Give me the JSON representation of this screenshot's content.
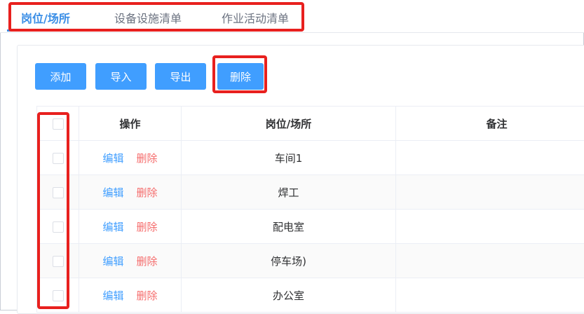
{
  "tabs": [
    {
      "label": "岗位/场所",
      "active": true
    },
    {
      "label": "设备设施清单",
      "active": false
    },
    {
      "label": "作业活动清单",
      "active": false
    }
  ],
  "toolbar": {
    "add_label": "添加",
    "import_label": "导入",
    "export_label": "导出",
    "delete_label": "删除"
  },
  "table": {
    "headers": {
      "action": "操作",
      "position": "岗位/场所",
      "remark": "备注"
    },
    "edit_label": "编辑",
    "delete_label": "删除",
    "rows": [
      {
        "position": "车间1",
        "remark": ""
      },
      {
        "position": "焊工",
        "remark": ""
      },
      {
        "position": "配电室",
        "remark": ""
      },
      {
        "position": "停车场)",
        "remark": ""
      },
      {
        "position": "办公室",
        "remark": ""
      }
    ]
  },
  "colors": {
    "primary": "#409eff",
    "danger": "#f56c6c",
    "highlight": "#e8201e"
  }
}
